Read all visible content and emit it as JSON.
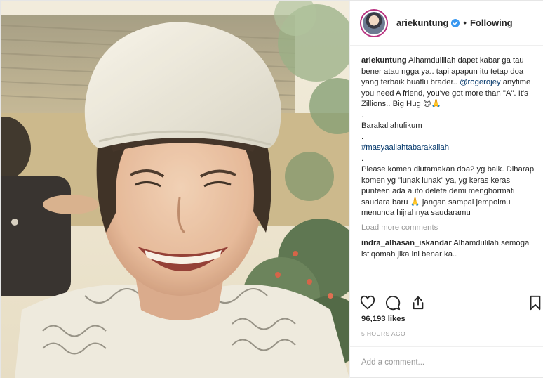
{
  "post": {
    "username": "ariekuntung",
    "follow_status": "Following",
    "separator": "•",
    "verified_icon": "verified-badge-icon",
    "accent_color": "#3897f0"
  },
  "caption": {
    "line1_text": "Alhamdulillah dapet kabar ga tau bener atau ngga ya.. tapi apapun itu tetap doa yang terbaik buatlu brader..",
    "mention": "@rogerojey",
    "line2_text": " anytime you need A friend, you've got more than \"A\". It's Zillions.. Big Hug 😊🙏",
    "dot1": ".",
    "line3": "Barakallahufikum",
    "dot2": ".",
    "hashtag": "#masyaallahtabarakallah",
    "dot3": ".",
    "line4": "Please komen diutamakan doa2 yg baik. Diharap komen yg \"lunak lunak\" ya, yg keras keras punteen ada auto delete demi menghormati saudara baru 🙏 jangan sampai jempolmu menunda hijrahnya saudaramu"
  },
  "load_more_label": "Load more comments",
  "comments": [
    {
      "username": "indra_alhasan_iskandar",
      "text": "Alhamdulilah,semoga istiqomah jika ini benar ka.."
    }
  ],
  "actions": {
    "like_icon": "heart-icon",
    "comment_icon": "comment-icon",
    "share_icon": "share-icon",
    "save_icon": "bookmark-icon"
  },
  "likes_label": "96,193 likes",
  "time_label": "5 HOURS AGO",
  "comment_box": {
    "placeholder": "Add a comment..."
  }
}
